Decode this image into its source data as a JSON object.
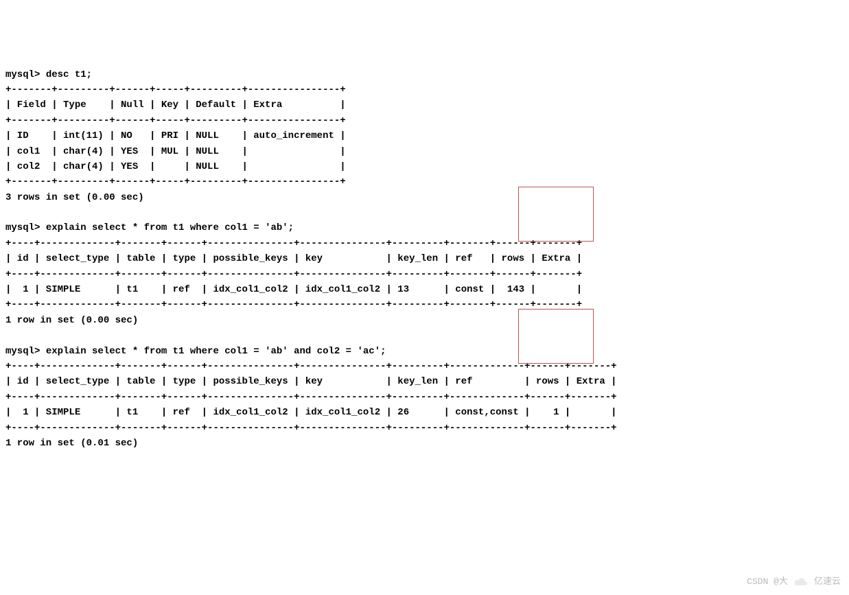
{
  "cmd1_prompt": "mysql> ",
  "cmd1": "desc t1;",
  "desc_border": "+-------+---------+------+-----+---------+----------------+",
  "desc_header": "| Field | Type    | Null | Key | Default | Extra          |",
  "desc_rows": [
    "| ID    | int(11) | NO   | PRI | NULL    | auto_increment |",
    "| col1  | char(4) | YES  | MUL | NULL    |                |",
    "| col2  | char(4) | YES  |     | NULL    |                |"
  ],
  "desc_footer": "3 rows in set (0.00 sec)",
  "cmd2_prompt": "mysql> ",
  "cmd2": "explain select * from t1 where col1 = 'ab';",
  "exp1_border": "+----+-------------+-------+------+---------------+---------------+---------+-------+------+-------+",
  "exp1_header": "| id | select_type | table | type | possible_keys | key           | key_len | ref   | rows | Extra |",
  "exp1_row": "|  1 | SIMPLE      | t1    | ref  | idx_col1_col2 | idx_col1_col2 | 13      | const |  143 |       |",
  "exp1_footer": "1 row in set (0.00 sec)",
  "cmd3_prompt": "mysql> ",
  "cmd3": "explain select * from t1 where col1 = 'ab' and col2 = 'ac';",
  "exp2_border": "+----+-------------+-------+------+---------------+---------------+---------+-------------+------+-------+",
  "exp2_header": "| id | select_type | table | type | possible_keys | key           | key_len | ref         | rows | Extra |",
  "exp2_row": "|  1 | SIMPLE      | t1    | ref  | idx_col1_col2 | idx_col1_col2 | 26      | const,const |    1 |       |",
  "exp2_footer": "1 row in set (0.01 sec)",
  "watermark1": "CSDN @大",
  "watermark2": "亿速云",
  "chart_data": [
    {
      "type": "table",
      "title": "desc t1",
      "columns": [
        "Field",
        "Type",
        "Null",
        "Key",
        "Default",
        "Extra"
      ],
      "rows": [
        [
          "ID",
          "int(11)",
          "NO",
          "PRI",
          "NULL",
          "auto_increment"
        ],
        [
          "col1",
          "char(4)",
          "YES",
          "MUL",
          "NULL",
          ""
        ],
        [
          "col2",
          "char(4)",
          "YES",
          "",
          "NULL",
          ""
        ]
      ],
      "footer": "3 rows in set (0.00 sec)"
    },
    {
      "type": "table",
      "title": "explain select * from t1 where col1 = 'ab'",
      "columns": [
        "id",
        "select_type",
        "table",
        "type",
        "possible_keys",
        "key",
        "key_len",
        "ref",
        "rows",
        "Extra"
      ],
      "rows": [
        [
          1,
          "SIMPLE",
          "t1",
          "ref",
          "idx_col1_col2",
          "idx_col1_col2",
          13,
          "const",
          143,
          ""
        ]
      ],
      "footer": "1 row in set (0.00 sec)"
    },
    {
      "type": "table",
      "title": "explain select * from t1 where col1 = 'ab' and col2 = 'ac'",
      "columns": [
        "id",
        "select_type",
        "table",
        "type",
        "possible_keys",
        "key",
        "key_len",
        "ref",
        "rows",
        "Extra"
      ],
      "rows": [
        [
          1,
          "SIMPLE",
          "t1",
          "ref",
          "idx_col1_col2",
          "idx_col1_col2",
          26,
          "const,const",
          1,
          ""
        ]
      ],
      "footer": "1 row in set (0.01 sec)"
    }
  ]
}
